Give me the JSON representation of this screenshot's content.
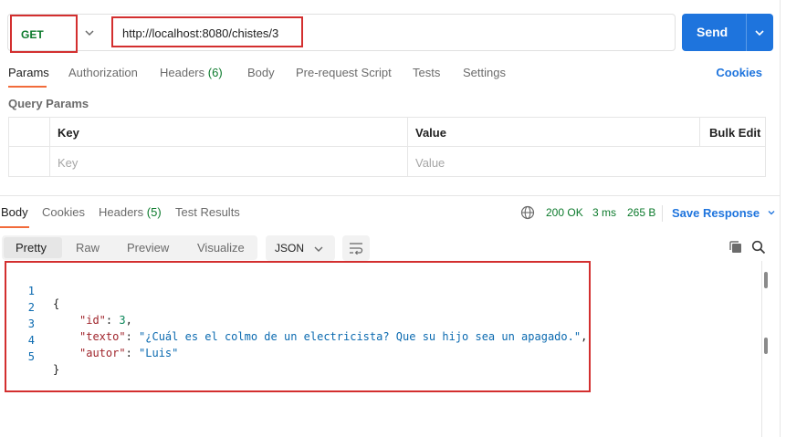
{
  "request": {
    "method": "GET",
    "url": "http://localhost:8080/chistes/3",
    "send_label": "Send"
  },
  "request_tabs": [
    {
      "label": "Params",
      "active": true
    },
    {
      "label": "Authorization"
    },
    {
      "label": "Headers",
      "count": "(6)"
    },
    {
      "label": "Body"
    },
    {
      "label": "Pre-request Script"
    },
    {
      "label": "Tests"
    },
    {
      "label": "Settings"
    }
  ],
  "cookies_link": "Cookies",
  "query_params": {
    "title": "Query Params",
    "headers": {
      "key": "Key",
      "value": "Value",
      "bulk_edit": "Bulk Edit"
    },
    "placeholders": {
      "key": "Key",
      "value": "Value"
    }
  },
  "response_tabs": [
    {
      "label": "Body",
      "active": true
    },
    {
      "label": "Cookies"
    },
    {
      "label": "Headers",
      "count": "(5)"
    },
    {
      "label": "Test Results"
    }
  ],
  "response_status": {
    "status": "200 OK",
    "time": "3 ms",
    "size": "265 B",
    "save_label": "Save Response"
  },
  "format_tabs": [
    "Pretty",
    "Raw",
    "Preview",
    "Visualize"
  ],
  "format_selected": "JSON",
  "code": {
    "line_numbers": [
      "1",
      "2",
      "3",
      "4",
      "5"
    ],
    "open_brace": "{",
    "close_brace": "}",
    "fields": [
      {
        "key": "\"id\"",
        "value": "3",
        "type": "number",
        "trail": ","
      },
      {
        "key": "\"texto\"",
        "value": "\"¿Cuál es el colmo de un electricista? Que su hijo sea un apagado.\"",
        "type": "string",
        "trail": ","
      },
      {
        "key": "\"autor\"",
        "value": "\"Luis\"",
        "type": "string",
        "trail": ""
      }
    ]
  },
  "colors": {
    "accent_blue": "#1e74dd",
    "method_green": "#0c7a2c",
    "tab_underline": "#f26b3a",
    "highlight_red": "#d32f2f"
  }
}
